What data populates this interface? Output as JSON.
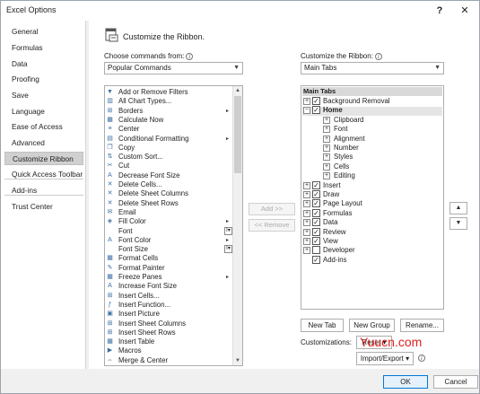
{
  "window": {
    "title": "Excel Options",
    "help_label": "?",
    "close_label": "✕"
  },
  "nav": {
    "items": [
      {
        "label": "General"
      },
      {
        "label": "Formulas"
      },
      {
        "label": "Data"
      },
      {
        "label": "Proofing"
      },
      {
        "label": "Save"
      },
      {
        "label": "Language"
      },
      {
        "label": "Ease of Access"
      },
      {
        "label": "Advanced"
      },
      {
        "label": "Customize Ribbon",
        "selected": true
      },
      {
        "label": "Quick Access Toolbar"
      },
      {
        "label": "Add-ins"
      },
      {
        "label": "Trust Center"
      }
    ]
  },
  "header": {
    "title": "Customize the Ribbon."
  },
  "left_panel": {
    "choose_label": "Choose commands from:",
    "choose_value": "Popular Commands",
    "commands": [
      {
        "label": "Add or Remove Filters",
        "icon": "filter-icon"
      },
      {
        "label": "All Chart Types...",
        "icon": "chart-icon"
      },
      {
        "label": "Borders",
        "icon": "borders-icon",
        "submenu": "▸"
      },
      {
        "label": "Calculate Now",
        "icon": "calculator-icon"
      },
      {
        "label": "Center",
        "icon": "align-center-icon"
      },
      {
        "label": "Conditional Formatting",
        "icon": "conditional-format-icon",
        "submenu": "▸"
      },
      {
        "label": "Copy",
        "icon": "copy-icon"
      },
      {
        "label": "Custom Sort...",
        "icon": "sort-icon"
      },
      {
        "label": "Cut",
        "icon": "scissors-icon"
      },
      {
        "label": "Decrease Font Size",
        "icon": "decrease-font-icon"
      },
      {
        "label": "Delete Cells...",
        "icon": "delete-cells-icon"
      },
      {
        "label": "Delete Sheet Columns",
        "icon": "delete-columns-icon"
      },
      {
        "label": "Delete Sheet Rows",
        "icon": "delete-rows-icon"
      },
      {
        "label": "Email",
        "icon": "email-icon"
      },
      {
        "label": "Fill Color",
        "icon": "fill-color-icon",
        "submenu": "▸"
      },
      {
        "label": "Font",
        "icon": "",
        "dropdown": "I▾"
      },
      {
        "label": "Font Color",
        "icon": "font-color-icon",
        "submenu": "▸"
      },
      {
        "label": "Font Size",
        "icon": "",
        "dropdown": "I▾"
      },
      {
        "label": "Format Cells",
        "icon": "format-cells-icon"
      },
      {
        "label": "Format Painter",
        "icon": "format-painter-icon"
      },
      {
        "label": "Freeze Panes",
        "icon": "freeze-panes-icon",
        "submenu": "▸"
      },
      {
        "label": "Increase Font Size",
        "icon": "increase-font-icon"
      },
      {
        "label": "Insert Cells...",
        "icon": "insert-cells-icon"
      },
      {
        "label": "Insert Function...",
        "icon": "function-icon"
      },
      {
        "label": "Insert Picture",
        "icon": "picture-icon"
      },
      {
        "label": "Insert Sheet Columns",
        "icon": "insert-columns-icon"
      },
      {
        "label": "Insert Sheet Rows",
        "icon": "insert-rows-icon"
      },
      {
        "label": "Insert Table",
        "icon": "table-icon"
      },
      {
        "label": "Macros",
        "icon": "macros-icon"
      },
      {
        "label": "Merge & Center",
        "icon": "merge-center-icon"
      }
    ]
  },
  "middle": {
    "add_label": "Add >>",
    "remove_label": "<< Remove"
  },
  "right_panel": {
    "customize_label": "Customize the Ribbon:",
    "customize_value": "Main Tabs",
    "tree_header": "Main Tabs",
    "tree": [
      {
        "label": "Background Removal",
        "level": 0,
        "expander": "⊞",
        "checked": true
      },
      {
        "label": "Home",
        "level": 0,
        "expander": "⊟",
        "checked": true,
        "selected": true
      },
      {
        "label": "Clipboard",
        "level": 1,
        "expander": "⊞"
      },
      {
        "label": "Font",
        "level": 1,
        "expander": "⊞"
      },
      {
        "label": "Alignment",
        "level": 1,
        "expander": "⊞"
      },
      {
        "label": "Number",
        "level": 1,
        "expander": "⊞"
      },
      {
        "label": "Styles",
        "level": 1,
        "expander": "⊞"
      },
      {
        "label": "Cells",
        "level": 1,
        "expander": "⊞"
      },
      {
        "label": "Editing",
        "level": 1,
        "expander": "⊞"
      },
      {
        "label": "Insert",
        "level": 0,
        "expander": "⊞",
        "checked": true
      },
      {
        "label": "Draw",
        "level": 0,
        "expander": "⊞",
        "checked": true
      },
      {
        "label": "Page Layout",
        "level": 0,
        "expander": "⊞",
        "checked": true
      },
      {
        "label": "Formulas",
        "level": 0,
        "expander": "⊞",
        "checked": true
      },
      {
        "label": "Data",
        "level": 0,
        "expander": "⊞",
        "checked": true
      },
      {
        "label": "Review",
        "level": 0,
        "expander": "⊞",
        "checked": true
      },
      {
        "label": "View",
        "level": 0,
        "expander": "⊞",
        "checked": true
      },
      {
        "label": "Developer",
        "level": 0,
        "expander": "⊞",
        "checked": false
      },
      {
        "label": "Add-ins",
        "level": 0,
        "expander": "",
        "checked": true
      }
    ],
    "move_up_label": "▲",
    "move_down_label": "▼",
    "new_tab_label": "New Tab",
    "new_group_label": "New Group",
    "rename_label": "Rename...",
    "customizations_label": "Customizations:",
    "reset_label": "Reset ▾",
    "import_export_label": "Import/Export ▾"
  },
  "footer": {
    "ok_label": "OK",
    "cancel_label": "Cancel"
  },
  "watermark": {
    "text": "Yuucn.com"
  },
  "colors": {
    "accent": "#0078d7",
    "selected_nav": "#d0d0d0",
    "watermark": "#e02020"
  }
}
